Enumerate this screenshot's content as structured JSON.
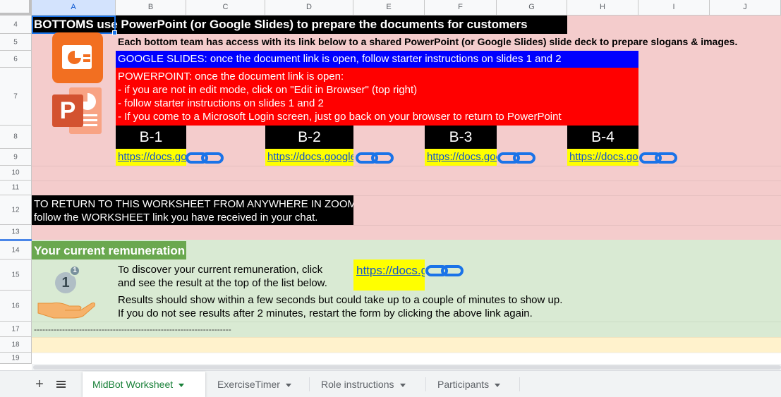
{
  "sheet": {
    "columns": [
      "A",
      "B",
      "C",
      "D",
      "E",
      "F",
      "G",
      "H",
      "I",
      "J"
    ],
    "rows": [
      "4",
      "5",
      "6",
      "7",
      "8",
      "9",
      "10",
      "11",
      "12",
      "13",
      "14",
      "15",
      "16",
      "17",
      "18",
      "19"
    ]
  },
  "bottoms": {
    "title": "BOTTOMS use PowerPoint (or Google Slides) to prepare the documents for customers",
    "intro": "Each bottom team has access with its link below to a shared PowerPoint (or Google Slides) slide deck to prepare slogans & images.",
    "google_slides": "GOOGLE SLIDES: once the document link is open, follow starter instructions on slides 1 and 2",
    "powerpoint": [
      "POWERPOINT: once the document link is open:",
      "- if you are not in edit mode, click on \"Edit in Browser\" (top right)",
      "- follow starter instructions on slides 1 and 2",
      "- If you come to a Microsoft Login screen, just go back on your browser to return to PowerPoint"
    ],
    "teams": [
      {
        "label": "B-1",
        "link": "https://docs.google.com"
      },
      {
        "label": "B-2",
        "link": "https://docs.google.com"
      },
      {
        "label": "B-3",
        "link": "https://docs.google.com"
      },
      {
        "label": "B-4",
        "link": "https://docs.google.com"
      }
    ],
    "return_note": [
      "TO RETURN TO THIS WORKSHEET FROM ANYWHERE IN ZOOM:",
      "follow the WORKSHEET link you have received in your  chat."
    ]
  },
  "remuneration": {
    "title": "Your current remuneration",
    "badge": "1",
    "instructions": [
      "To discover your current remuneration, click",
      "and see the result at the top of the list below."
    ],
    "link": "https://docs.google.com",
    "results_note": [
      "Results should show within a few seconds but could take up to a couple of minutes to show up.",
      "If you do not see results after 2 minutes, restart the form by clicking the above link again."
    ],
    "separator": "----------------------------------------------------------------------"
  },
  "tabs": [
    {
      "label": "MidBot Worksheet",
      "active": true
    },
    {
      "label": "ExerciseTimer",
      "active": false
    },
    {
      "label": "Role instructions",
      "active": false
    },
    {
      "label": "Participants",
      "active": false
    }
  ],
  "colors": {
    "pink_band": "#f4cccc",
    "green_band": "#d9ead3",
    "yellow_band": "#fff2cc",
    "google_blue": "#0000ff",
    "pp_red": "#ff0000",
    "link_yellow": "#ffff00",
    "green_header": "#6aa84f",
    "active_tab_text": "#188038"
  }
}
